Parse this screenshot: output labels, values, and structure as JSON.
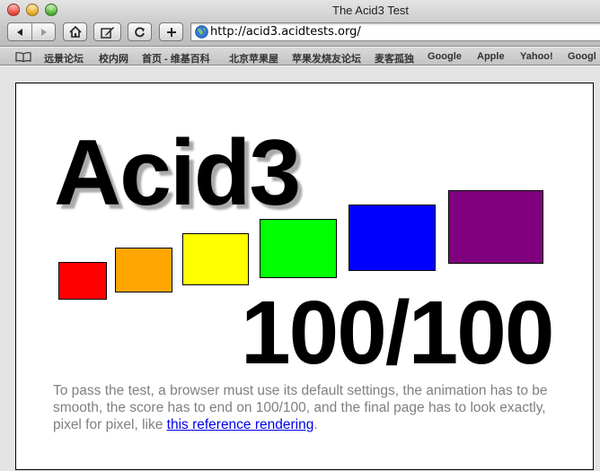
{
  "window": {
    "title": "The Acid3 Test"
  },
  "toolbar": {
    "back_icon": "back-arrow-icon",
    "forward_icon": "forward-arrow-icon",
    "home_icon": "home-icon",
    "edit_icon": "edit-pencil-icon",
    "reload_icon": "reload-icon",
    "add_icon": "add-bookmark-icon",
    "address_url": "http://acid3.acidtests.org/"
  },
  "bookmarks": {
    "items": [
      "远景论坛",
      "校内网",
      "首页 - 维基百科",
      "北京苹果屋",
      "苹果发烧友论坛",
      "麦客孤独",
      "Google",
      "Apple",
      "Yahoo!",
      "Googl"
    ]
  },
  "page": {
    "heading": "Acid3",
    "score": "100/100",
    "boxes": [
      "#ff0000",
      "#ffa500",
      "#ffff00",
      "#00ff00",
      "#0000ff",
      "#800080"
    ],
    "note_text": "To pass the test, a browser must use its default settings, the animation has to be smooth, the score has to end on 100/100, and the final page has to look exactly, pixel for pixel, like ",
    "note_link": "this reference rendering",
    "note_end": "."
  }
}
